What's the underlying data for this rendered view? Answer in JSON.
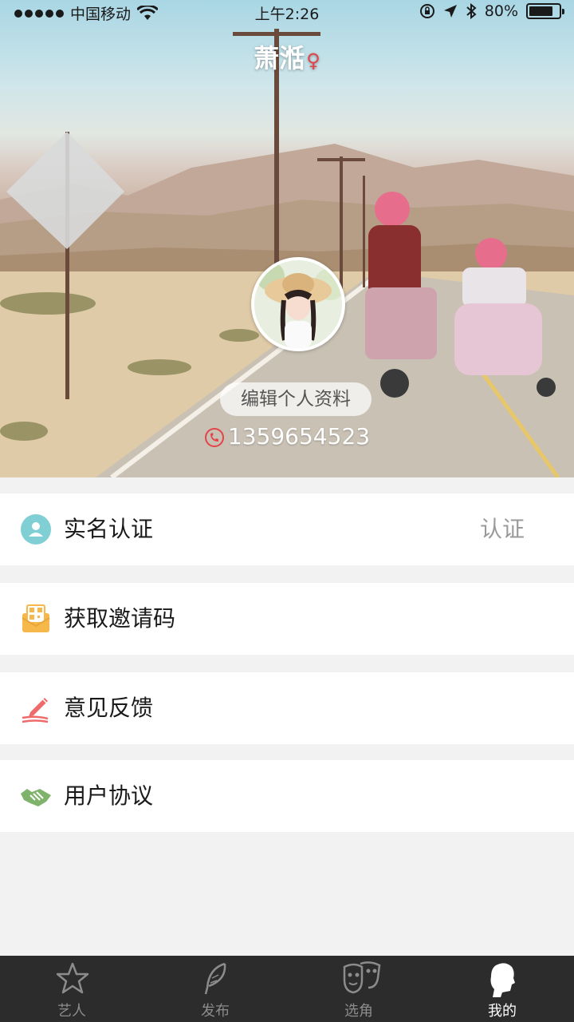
{
  "status_bar": {
    "carrier": "中国移动",
    "time": "上午2:26",
    "battery": "80%",
    "battery_level": 0.8
  },
  "profile": {
    "name": "萧湉",
    "gender_symbol": "♀",
    "edit_label": "编辑个人资料",
    "phone": "1359654523"
  },
  "menu": {
    "realname": {
      "label": "实名认证",
      "value": "认证"
    },
    "invite": {
      "label": "获取邀请码"
    },
    "feedback": {
      "label": "意见反馈"
    },
    "agreement": {
      "label": "用户协议"
    }
  },
  "tabs": [
    {
      "label": "艺人",
      "icon": "star-icon",
      "active": false
    },
    {
      "label": "发布",
      "icon": "feather-icon",
      "active": false
    },
    {
      "label": "选角",
      "icon": "masks-icon",
      "active": false
    },
    {
      "label": "我的",
      "icon": "profile-head-icon",
      "active": true
    }
  ],
  "colors": {
    "accent_red": "#e2444a",
    "realname_icon": "#7fcfd4",
    "invite_icon": "#f6b84a",
    "feedback_icon": "#ef6a6a",
    "agreement_icon": "#7fb36b",
    "tab_bar_bg": "#2c2c2c"
  }
}
